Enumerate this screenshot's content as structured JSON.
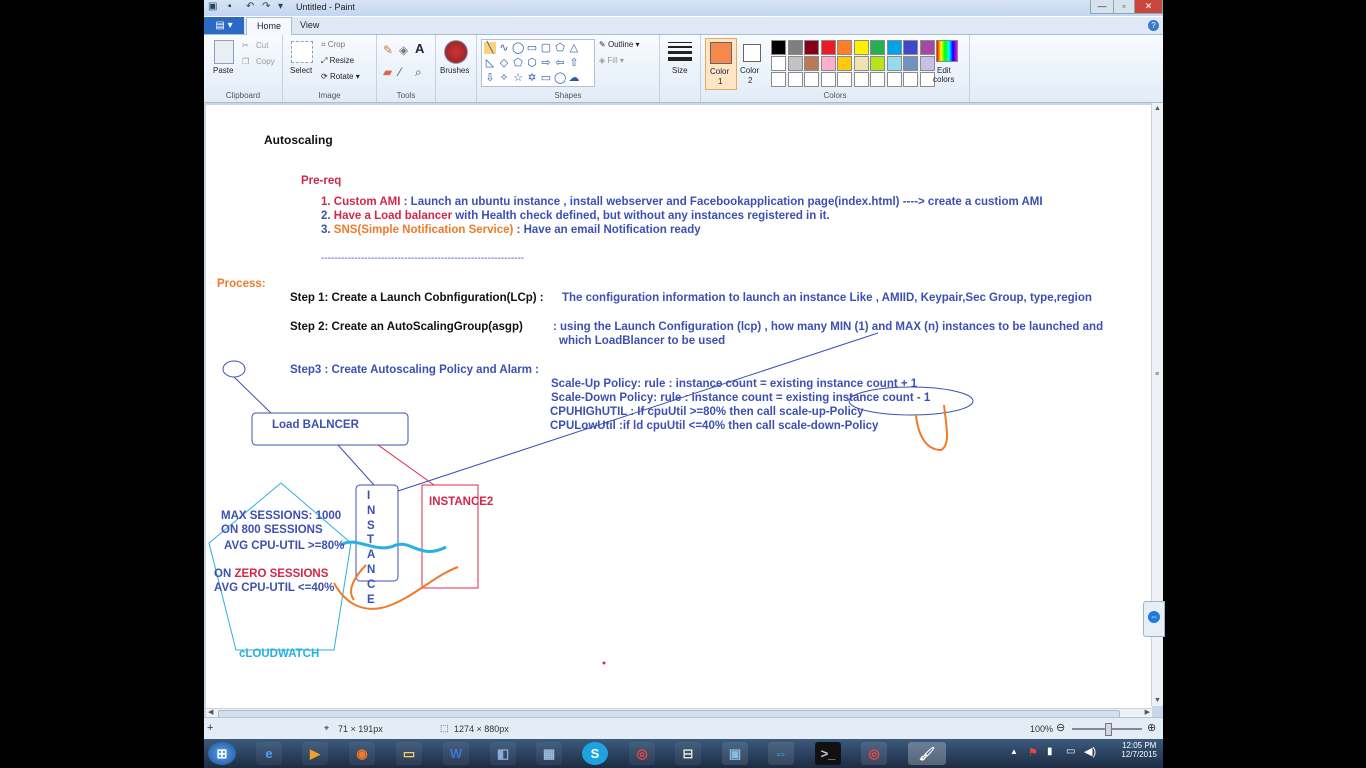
{
  "window": {
    "title": "Untitled - Paint",
    "controls": {
      "minimize": "—",
      "maximize": "▫",
      "close": "✕"
    }
  },
  "ribbon_tabs": [
    {
      "label": "Home",
      "active": true
    },
    {
      "label": "View",
      "active": false
    }
  ],
  "ribbon": {
    "clipboard": {
      "paste": "Paste",
      "cut": "Cut",
      "copy": "Copy",
      "group": "Clipboard"
    },
    "image": {
      "select": "Select",
      "crop": "Crop",
      "resize": "Resize",
      "rotate": "Rotate",
      "group": "Image"
    },
    "tools": {
      "group": "Tools"
    },
    "brushes": {
      "label": "Brushes"
    },
    "shapes": {
      "outline": "Outline",
      "fill": "Fill",
      "group": "Shapes"
    },
    "size": {
      "label": "Size"
    },
    "colors": {
      "color1": "Color",
      "color1_num": "1",
      "color2": "Color",
      "color2_num": "2",
      "edit": "Edit",
      "edit2": "colors",
      "group": "Colors",
      "color1_value": "#f5884a",
      "color2_value": "#ffffff",
      "palette_row1": [
        "#000000",
        "#7f7f7f",
        "#880015",
        "#ed1c24",
        "#ff7f27",
        "#fff200",
        "#22b14c",
        "#00a2e8",
        "#3f48cc",
        "#a349a4"
      ],
      "palette_row2": [
        "#ffffff",
        "#c3c3c3",
        "#b97a57",
        "#ffaec9",
        "#ffc90e",
        "#efe4b0",
        "#b5e61d",
        "#99d9ea",
        "#7092be",
        "#c8bfe7"
      ]
    }
  },
  "canvas": {
    "heading": "Autoscaling",
    "prereq_title": "Pre-req",
    "prereq": [
      {
        "num": "1.",
        "head": "Custom AMI",
        "rest": " : Launch an ubuntu instance , install webserver and Facebookapplication page(index.html)     ----> create a custiom AMI"
      },
      {
        "num": "2.",
        "head": "Have a Load balancer",
        "rest": " with Health check defined, but  without any instances registered in it."
      },
      {
        "num": "3.",
        "head": "SNS(Simple Notification Service)",
        "rest": " : Have an email Notification ready"
      }
    ],
    "dashes": "-------------------------------------------------------------",
    "process_title": "Process:",
    "step1_label": "Step 1:  Create a Launch Cobnfiguration(LCp) :",
    "step1_desc": "The configuration information to launch an instance Like , AMIID, Keypair,Sec Group, type,region",
    "step2_label": "Step 2:  Create an AutoScalingGroup(asgp)",
    "step2_desc1": ": using the Launch Configuration (lcp) , how many MIN (1)  and MAX (n) instances to be launched and",
    "step2_desc2": "which LoadBlancer to be used",
    "step3_label": "Step3 :   Create Autoscaling Policy and Alarm :",
    "policies": [
      "Scale-Up Policy:    rule : instance count = existing instance count + 1",
      "Scale-Down Policy:    rule : instance count = existing instance count - 1",
      "CPUHIGhUTIL   : If cpuUtil >=80%  then call scale-up-Policy",
      "CPULowUtil        :if  ld cpuUtil <=40%  then call scale-down-Policy"
    ],
    "load_balancer": "Load BALNCER",
    "instance_letters": [
      "I",
      "N",
      "S",
      "T",
      "A",
      "N",
      "C",
      "E"
    ],
    "instance2": "INSTANCE2",
    "cw_line1": "MAX SESSIONS: 1000",
    "cw_line2": "ON 800 SESSIONS",
    "cw_line3": "AVG CPU-UTIL >=80%",
    "cw_line4a": "ON ",
    "cw_line4b": "ZERO SESSIONS",
    "cw_line5": "AVG CPU-UTIL <=40%",
    "cloudwatch": "cLOUDWATCH"
  },
  "status": {
    "cursor": "71 × 191px",
    "canvas_size": "1274 × 880px",
    "zoom": "100%"
  },
  "taskbar": {
    "apps": [
      "start",
      "ie",
      "media",
      "firefox",
      "folder",
      "word",
      "apps",
      "calc",
      "skype",
      "chrome",
      "remote",
      "monitor",
      "teamviewer",
      "cmd",
      "chrome2",
      "paint"
    ],
    "time": "12:05 PM",
    "date": "12/7/2015"
  }
}
